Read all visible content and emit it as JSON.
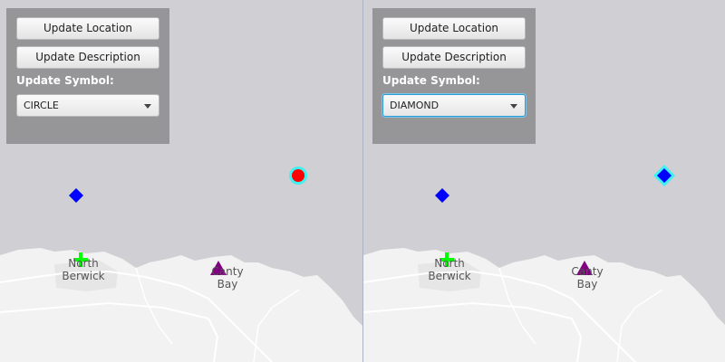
{
  "views": [
    {
      "id": "left",
      "buttons": {
        "update_location": "Update Location",
        "update_description": "Update Description"
      },
      "symbol_label": "Update Symbol:",
      "symbol_selected": "CIRCLE",
      "combo_focused": false,
      "graphics": {
        "selected_marker_shape": "circle",
        "selected_marker_color": "#ff0000",
        "selection_halo_color": "#00ffff",
        "blue_marker_color": "#0000ff",
        "green_marker_color": "#00ff00",
        "triangle_color": "#800080"
      },
      "places": [
        {
          "name_line1": "North",
          "name_line2": "Berwick"
        },
        {
          "name_line1": "Canty",
          "name_line2": "Bay"
        }
      ]
    },
    {
      "id": "right",
      "buttons": {
        "update_location": "Update Location",
        "update_description": "Update Description"
      },
      "symbol_label": "Update Symbol:",
      "symbol_selected": "DIAMOND",
      "combo_focused": true,
      "graphics": {
        "selected_marker_shape": "diamond",
        "selected_marker_color": "#0000ff",
        "selection_halo_color": "#00ffff",
        "blue_marker_color": "#0000ff",
        "green_marker_color": "#00ff00",
        "triangle_color": "#800080"
      },
      "places": [
        {
          "name_line1": "North",
          "name_line2": "Berwick"
        },
        {
          "name_line1": "Canty",
          "name_line2": "Bay"
        }
      ]
    }
  ],
  "colors": {
    "water": "#d0cfd4",
    "land": "#f2f2f2",
    "road": "#ffffff",
    "divider": "#a9b4c2"
  }
}
